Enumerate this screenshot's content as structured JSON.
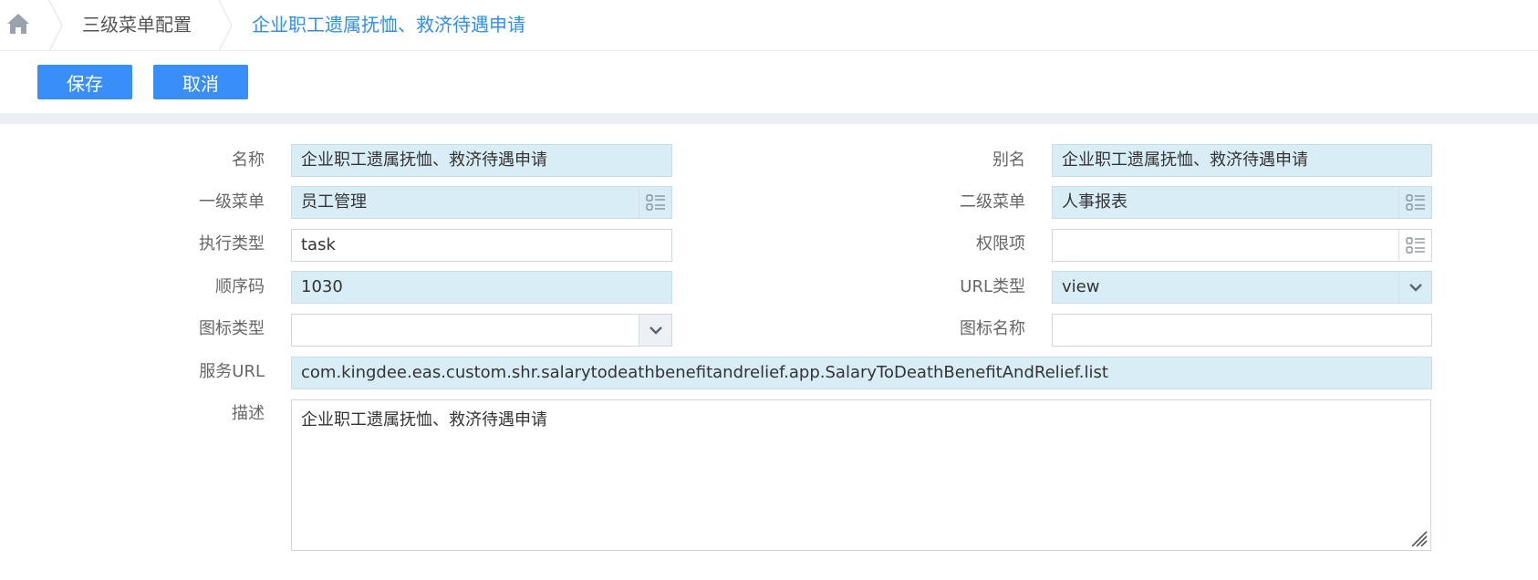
{
  "breadcrumb": {
    "home_icon": "home-icon",
    "level": "三级菜单配置",
    "current": "企业职工遗属抚恤、救济待遇申请"
  },
  "toolbar": {
    "save_label": "保存",
    "cancel_label": "取消"
  },
  "form": {
    "name": {
      "label": "名称",
      "value": "企业职工遗属抚恤、救济待遇申请"
    },
    "alias": {
      "label": "别名",
      "value": "企业职工遗属抚恤、救济待遇申请"
    },
    "menu1": {
      "label": "一级菜单",
      "value": "员工管理"
    },
    "menu2": {
      "label": "二级菜单",
      "value": "人事报表"
    },
    "exec_type": {
      "label": "执行类型",
      "value": "task"
    },
    "permission": {
      "label": "权限项",
      "value": ""
    },
    "order": {
      "label": "顺序码",
      "value": "1030"
    },
    "url_type": {
      "label": "URL类型",
      "value": "view"
    },
    "icon_type": {
      "label": "图标类型",
      "value": ""
    },
    "icon_name": {
      "label": "图标名称",
      "value": ""
    },
    "service_url": {
      "label": "服务URL",
      "value": "com.kingdee.eas.custom.shr.salarytodeathbenefitandrelief.app.SalaryToDeathBenefitAndRelief.list"
    },
    "description": {
      "label": "描述",
      "value": "企业职工遗属抚恤、救济待遇申请"
    }
  },
  "colors": {
    "accent": "#3a8ef7",
    "link": "#2f8ef6",
    "readonly_bg": "#d9edf6"
  }
}
